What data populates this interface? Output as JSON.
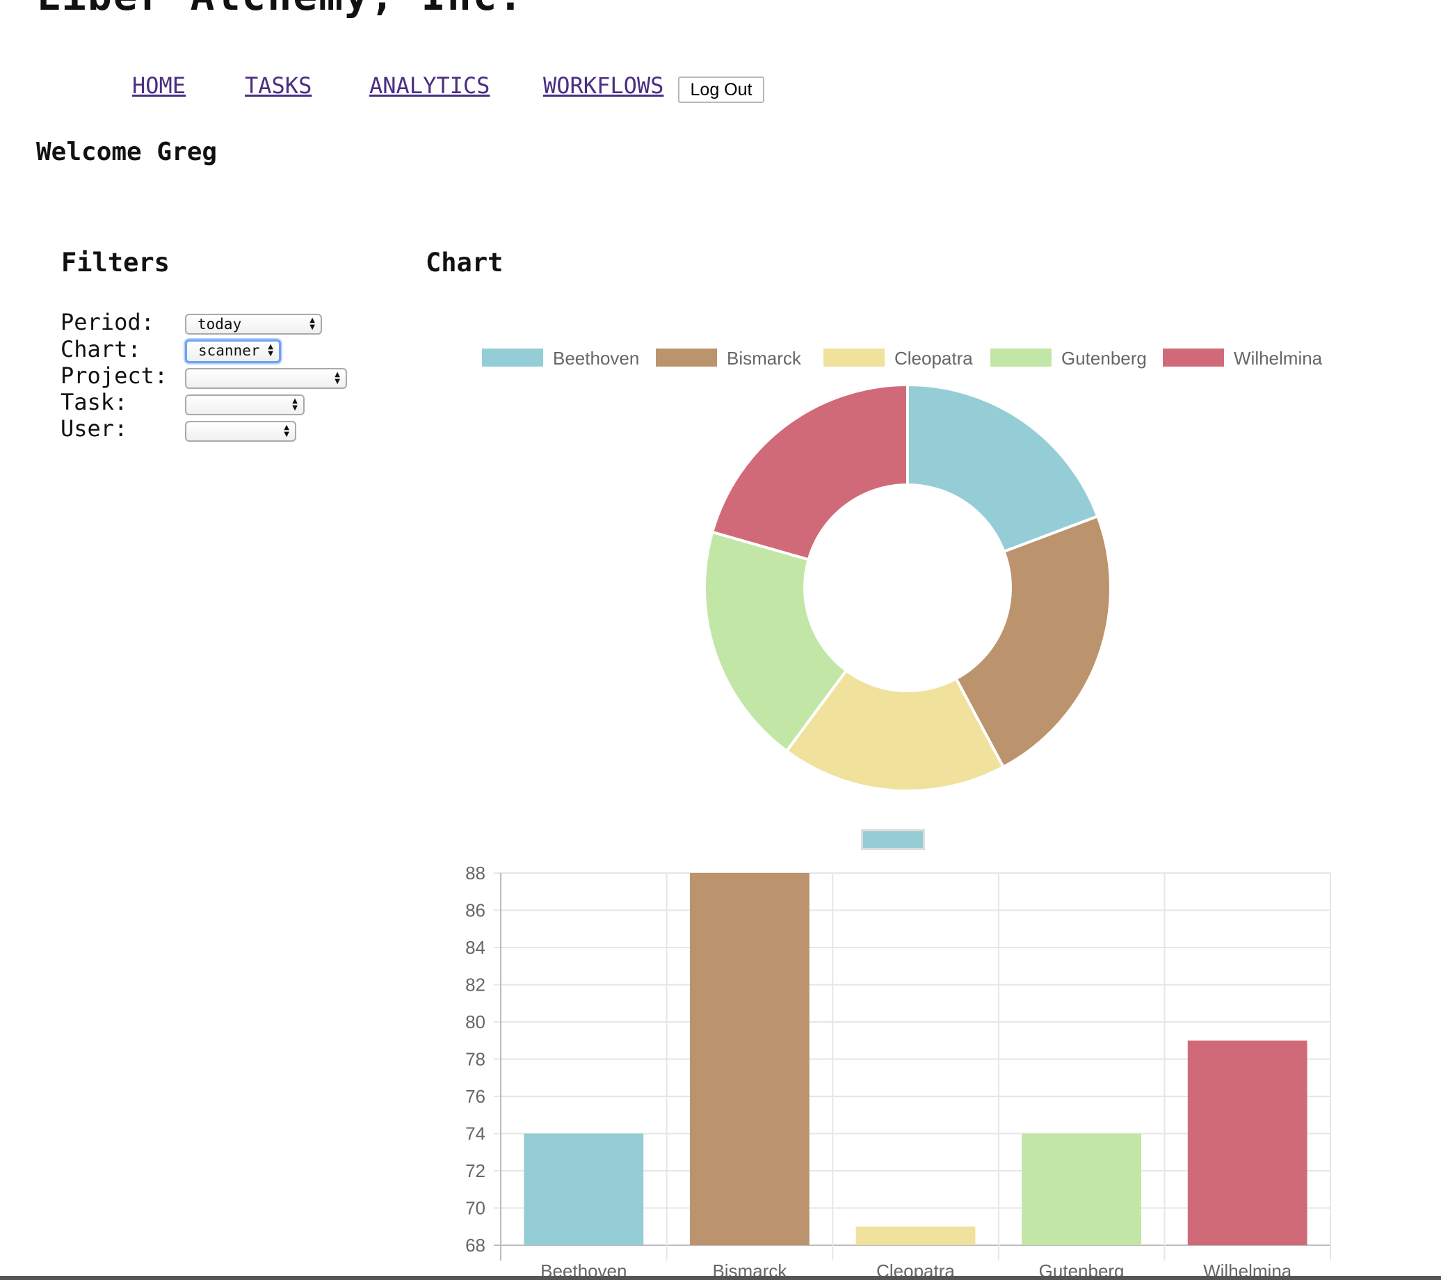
{
  "header": {
    "company": "Liber Alchemy, Inc.",
    "nav": [
      "HOME",
      "TASKS",
      "ANALYTICS",
      "WORKFLOWS"
    ],
    "logout_label": "Log Out"
  },
  "welcome": "Welcome Greg",
  "filters": {
    "heading": "Filters",
    "period_label": "Period:",
    "period_value": "today",
    "chart_label": "Chart:",
    "chart_value": "scanner",
    "project_label": "Project:",
    "project_value": "",
    "task_label": "Task:",
    "task_value": "",
    "user_label": "User:",
    "user_value": ""
  },
  "chart_section": {
    "heading": "Chart"
  },
  "chart_data": [
    {
      "type": "pie",
      "variant": "doughnut",
      "legend_position": "top",
      "categories": [
        "Beethoven",
        "Bismarck",
        "Cleopatra",
        "Gutenberg",
        "Wilhelmina"
      ],
      "values": [
        74,
        88,
        69,
        74,
        79
      ],
      "colors": [
        "#94cdd6",
        "#bb936d",
        "#f0e29c",
        "#c2e6a6",
        "#d16a78"
      ]
    },
    {
      "type": "bar",
      "categories": [
        "Beethoven",
        "Bismarck",
        "Cleopatra",
        "Gutenberg",
        "Wilhelmina"
      ],
      "series": [
        {
          "values": [
            74,
            88,
            69,
            74,
            79
          ]
        }
      ],
      "colors": [
        "#94cdd6",
        "#bb936d",
        "#f0e29c",
        "#c2e6a6",
        "#d16a78"
      ],
      "ylim": [
        68,
        88
      ],
      "yticks": [
        "88",
        "86",
        "84",
        "82",
        "80",
        "78",
        "76",
        "74",
        "72",
        "70",
        "68"
      ],
      "grid": true,
      "legend_position": "top",
      "legend_color": "#94cdd6"
    }
  ]
}
